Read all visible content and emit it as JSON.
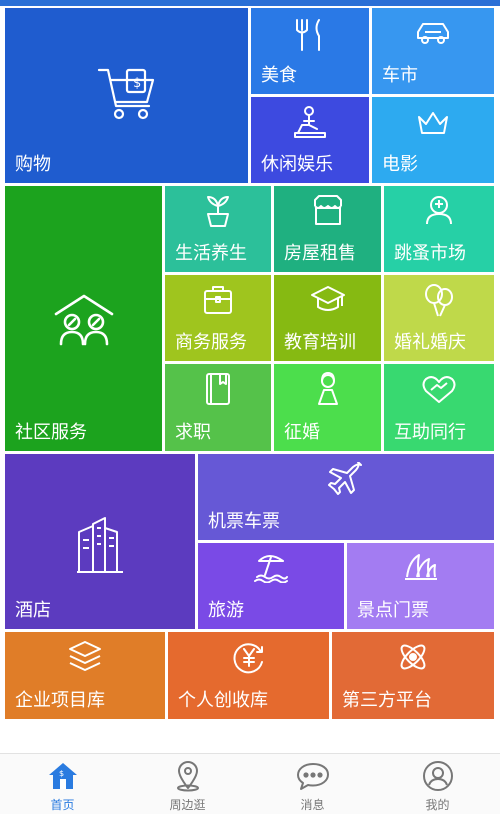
{
  "tiles": {
    "shopping": {
      "label": "购物",
      "icon": "shopping-cart-icon"
    },
    "food": {
      "label": "美食",
      "icon": "fork-knife-icon"
    },
    "car_market": {
      "label": "车市",
      "icon": "car-icon"
    },
    "leisure": {
      "label": "休闲娱乐",
      "icon": "massage-icon"
    },
    "movie": {
      "label": "电影",
      "icon": "crown-icon"
    },
    "community": {
      "label": "社区服务",
      "icon": "community-house-icon"
    },
    "health": {
      "label": "生活养生",
      "icon": "plant-icon"
    },
    "housing": {
      "label": "房屋租售",
      "icon": "shop-awning-icon"
    },
    "flea_market": {
      "label": "跳蚤市场",
      "icon": "person-badge-icon"
    },
    "business": {
      "label": "商务服务",
      "icon": "briefcase-icon"
    },
    "education": {
      "label": "教育培训",
      "icon": "graduation-cap-icon"
    },
    "wedding": {
      "label": "婚礼婚庆",
      "icon": "balloons-icon"
    },
    "jobs": {
      "label": "求职",
      "icon": "book-icon"
    },
    "marriage": {
      "label": "征婚",
      "icon": "bride-icon"
    },
    "mutual_help": {
      "label": "互助同行",
      "icon": "handshake-icon"
    },
    "hotel": {
      "label": "酒店",
      "icon": "hotel-building-icon"
    },
    "tickets": {
      "label": "机票车票",
      "icon": "airplane-icon"
    },
    "travel": {
      "label": "旅游",
      "icon": "beach-umbrella-icon"
    },
    "scenic_tickets": {
      "label": "景点门票",
      "icon": "opera-house-icon"
    },
    "enterprise_projects": {
      "label": "企业项目库",
      "icon": "layers-icon"
    },
    "personal_income": {
      "label": "个人创收库",
      "icon": "yen-cycle-icon"
    },
    "third_party": {
      "label": "第三方平台",
      "icon": "atom-icon"
    }
  },
  "tabbar": {
    "home": {
      "label": "首页",
      "icon": "home-icon",
      "active": true
    },
    "nearby": {
      "label": "周边逛",
      "icon": "location-pin-icon"
    },
    "messages": {
      "label": "消息",
      "icon": "chat-bubble-icon"
    },
    "mine": {
      "label": "我的",
      "icon": "avatar-icon"
    }
  },
  "colors": {
    "shopping": "#1f5ccf",
    "food": "#2a79e6",
    "car_market": "#3797f0",
    "leisure": "#3d4ae0",
    "movie": "#2daaf0",
    "community": "#1ca31e",
    "health": "#2cc09a",
    "housing": "#1fb080",
    "flea_market": "#26d0a6",
    "business": "#9fc51e",
    "education": "#86ba12",
    "wedding": "#bfd94a",
    "jobs": "#55c24a",
    "marriage": "#4cde4c",
    "mutual_help": "#38d970",
    "hotel": "#5c3bbf",
    "tickets": "#6658d6",
    "travel": "#7a4ae6",
    "scenic_tickets": "#a37cf2",
    "enterprise_projects": "#e07d28",
    "personal_income": "#e56a2e",
    "third_party": "#e26a36",
    "tab_active": "#2a7be0"
  }
}
